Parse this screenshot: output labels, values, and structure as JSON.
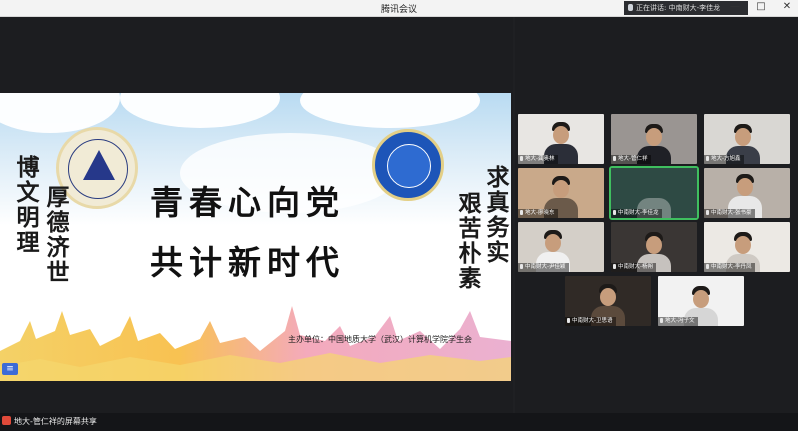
{
  "window": {
    "title": "腾讯会议",
    "speaking_label": "正在讲话: 中南财大-李佳龙",
    "controls": [
      "—",
      "□",
      "✕"
    ]
  },
  "slide": {
    "title_line1": "青春心向党",
    "title_line2": "共计新时代",
    "left_motto_col1": "博文明理",
    "left_motto_col2": "厚德济世",
    "right_motto_col1": "求真务实",
    "right_motto_col2": "艰苦朴素",
    "organizer": "主办单位：中国地质大学（武汉）计算机学院学生会"
  },
  "participants": [
    {
      "label": "地大-龚奥林",
      "wall": "#e8e6e3",
      "body": "#2b2e38"
    },
    {
      "label": "地大-管仁祥",
      "wall": "#9a9592",
      "body": "#1f2026"
    },
    {
      "label": "地大-方旭鑫",
      "wall": "#d9d7d3",
      "body": "#3a3e48"
    },
    {
      "label": "地大-廖晓东",
      "wall": "#c9a98a",
      "body": "#6b5a4a"
    },
    {
      "label": "中南财大-李佳龙",
      "wall": "#2e4a44",
      "body": "#dcdcdc"
    },
    {
      "label": "中南财大-张书豪",
      "wall": "#b8b0a8",
      "body": "#e8e8e8"
    },
    {
      "label": "中南财大-尹佳颖",
      "wall": "#d4cfc8",
      "body": "#f0f0f0"
    },
    {
      "label": "中南财大-杨朔",
      "wall": "#3a3634",
      "body": "#c6c2be"
    },
    {
      "label": "中南财大-李丹凤",
      "wall": "#ece9e4",
      "body": "#cfcac4"
    },
    {
      "label": "中南财大-卫思语",
      "wall": "#302a26",
      "body": "#5b4a3c"
    },
    {
      "label": "地大-冯子文",
      "wall": "#f2f2f2",
      "body": "#d6d6d6"
    }
  ],
  "footer": {
    "sharer_label": "地大-管仁祥的屏幕共享"
  }
}
